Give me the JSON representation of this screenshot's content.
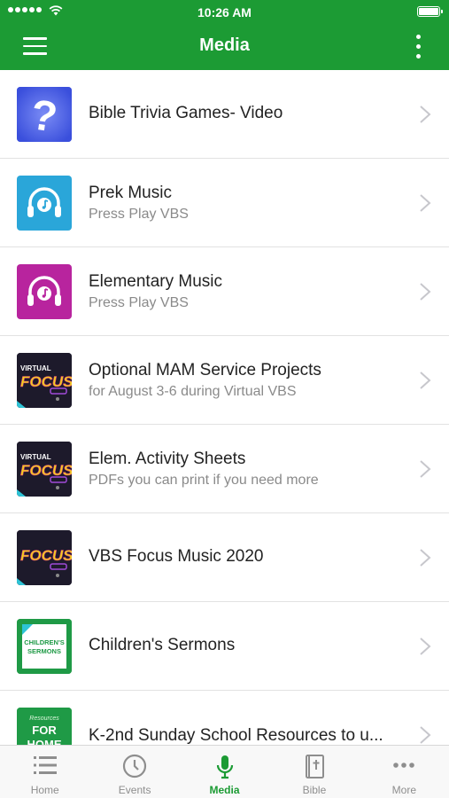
{
  "status_bar": {
    "time": "10:26 AM"
  },
  "header": {
    "title": "Media"
  },
  "colors": {
    "brand_green": "#1c9b34",
    "trivia_blue": "#4b63e6",
    "prek_cyan": "#2aa6d9",
    "elementary_magenta": "#b8249e"
  },
  "media_items": [
    {
      "title": "Bible Trivia Games- Video",
      "subtitle": "",
      "thumb": "question-mark-icon"
    },
    {
      "title": "Prek Music",
      "subtitle": "Press Play VBS",
      "thumb": "headphones-icon"
    },
    {
      "title": "Elementary Music",
      "subtitle": "Press Play VBS",
      "thumb": "headphones-icon"
    },
    {
      "title": "Optional MAM Service Projects",
      "subtitle": "for August 3-6 during Virtual VBS",
      "thumb": "virtual-focus-art"
    },
    {
      "title": "Elem. Activity Sheets",
      "subtitle": "PDFs you can print if you need more",
      "thumb": "virtual-focus-art"
    },
    {
      "title": "VBS Focus Music 2020",
      "subtitle": "",
      "thumb": "focus-art"
    },
    {
      "title": "Children's Sermons",
      "subtitle": "",
      "thumb": "childrens-sermons-art"
    },
    {
      "title": "K-2nd Sunday School Resources to u...",
      "subtitle": "",
      "thumb": "for-home-art"
    }
  ],
  "thumb_art": {
    "virtual_focus": {
      "line1": "VIRTUAL",
      "line2": "FOCUS"
    },
    "focus": {
      "line1": "FOCUS"
    },
    "childrens_sermons": {
      "line1": "CHILDREN'S",
      "line2": "SERMONS"
    },
    "for_home": {
      "line1": "Resources",
      "line2": "FOR",
      "line3": "HOME"
    }
  },
  "tabs": [
    {
      "label": "Home",
      "icon": "list-icon",
      "active": false
    },
    {
      "label": "Events",
      "icon": "clock-icon",
      "active": false
    },
    {
      "label": "Media",
      "icon": "microphone-icon",
      "active": true
    },
    {
      "label": "Bible",
      "icon": "bible-icon",
      "active": false
    },
    {
      "label": "More",
      "icon": "more-dots-icon",
      "active": false
    }
  ]
}
